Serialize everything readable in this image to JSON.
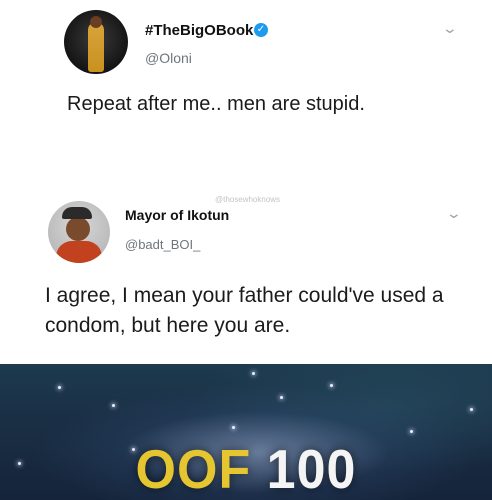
{
  "tweet1": {
    "name": "#TheBigOBook",
    "handle": "@Oloni",
    "text": "Repeat after me.. men are stupid."
  },
  "tweet2": {
    "name": "Mayor of Ikotun",
    "handle": "@badt_BOI_",
    "watermark": "@thosewhoknows",
    "text": "I agree, I mean your father could've used a condom, but here you are."
  },
  "meme": {
    "word1": "OOF",
    "word2": "100"
  },
  "icons": {
    "verified": "verified-badge-icon",
    "chevron": "chevron-down-icon"
  },
  "colors": {
    "verified": "#1d9bf0",
    "oof": "#e5c630"
  }
}
